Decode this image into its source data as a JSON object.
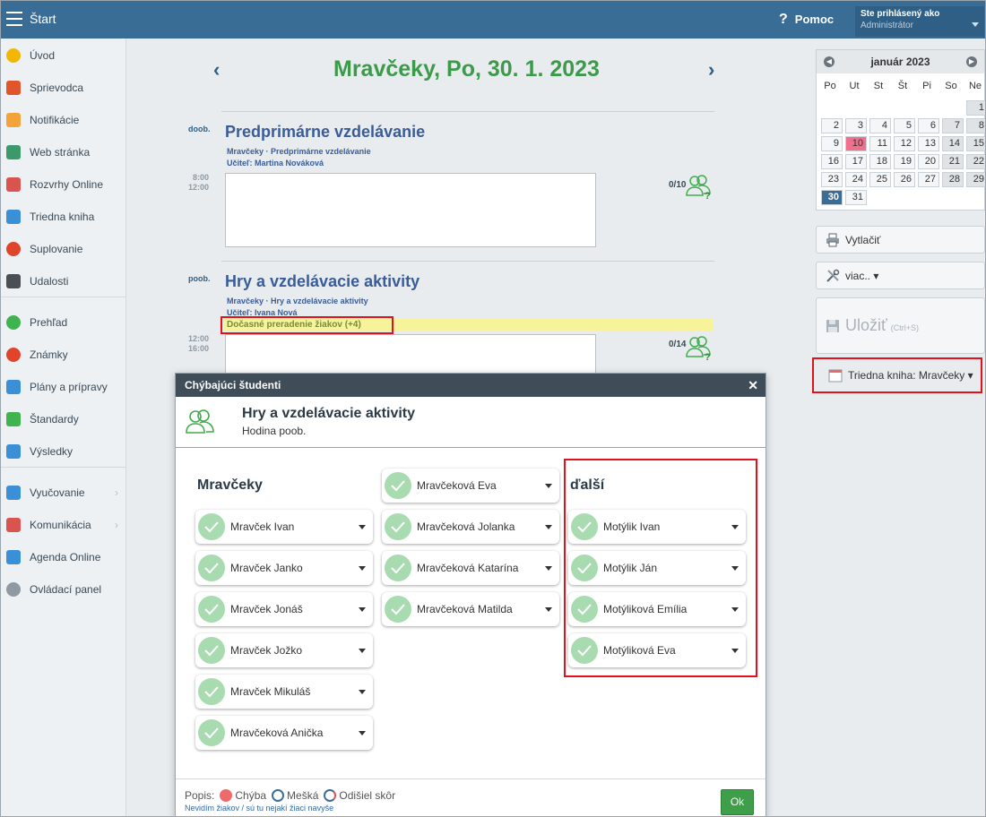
{
  "topbar": {
    "start_label": "Štart",
    "help_label": "Pomoc",
    "user_line1": "Ste prihlásený ako",
    "user_line2": "Administrátor"
  },
  "sidebar": {
    "items": [
      {
        "label": "Úvod",
        "icon": "star-icon",
        "color": "#f2b705"
      },
      {
        "label": "Sprievodca",
        "icon": "wand-icon",
        "color": "#e0552b"
      },
      {
        "label": "Notifikácie",
        "icon": "envelope-icon",
        "color": "#f2a43a"
      },
      {
        "label": "Web stránka",
        "icon": "home-icon",
        "color": "#3c9a6a"
      },
      {
        "label": "Rozvrhy Online",
        "icon": "grid-calendar-icon",
        "color": "#d9534f"
      },
      {
        "label": "Triedna kniha",
        "icon": "book-icon",
        "color": "#3a8fd6"
      },
      {
        "label": "Suplovanie",
        "icon": "person-icon",
        "color": "#e0442b"
      },
      {
        "label": "Udalosti",
        "icon": "calendar-icon",
        "color": "#4a4f55"
      },
      {
        "label": "Prehľad",
        "icon": "check-circle-icon",
        "color": "#3fb34f"
      },
      {
        "label": "Známky",
        "icon": "grade-icon",
        "color": "#e0442b"
      },
      {
        "label": "Plány a prípravy",
        "icon": "briefcase-icon",
        "color": "#3a8fd6"
      },
      {
        "label": "Štandardy",
        "icon": "shield-icon",
        "color": "#3fb34f"
      },
      {
        "label": "Výsledky",
        "icon": "bar-chart-icon",
        "color": "#3a8fd6"
      },
      {
        "label": "Vyučovanie",
        "icon": "open-book-icon",
        "color": "#3a8fd6"
      },
      {
        "label": "Komunikácia",
        "icon": "chat-icon",
        "color": "#d9534f"
      },
      {
        "label": "Agenda Online",
        "icon": "pen-icon",
        "color": "#3a8fd6"
      },
      {
        "label": "Ovládací panel",
        "icon": "gear-icon",
        "color": "#8e99a3"
      }
    ]
  },
  "main": {
    "date_title": "Mravčeky, Po, 30. 1. 2023",
    "lessons": [
      {
        "tag": "doob.",
        "time_start": "8:00",
        "time_end": "12:00",
        "title": "Predprimárne vzdelávanie",
        "sub1": "Mravčeky · Predprimárne vzdelávanie",
        "sub2": "Učiteľ:   Martina Nováková",
        "count": "0/10"
      },
      {
        "tag": "poob.",
        "time_start": "12:00",
        "time_end": "16:00",
        "title": "Hry a vzdelávacie aktivity",
        "sub1": "Mravčeky · Hry a vzdelávacie aktivity",
        "sub2": "Učiteľ:   Ivana Nová",
        "count": "0/14",
        "note": "Dočasné preradenie žiakov (+4)"
      }
    ]
  },
  "calendar": {
    "month": "január 2023",
    "dow": [
      "Po",
      "Ut",
      "St",
      "Št",
      "Pi",
      "So",
      "Ne"
    ],
    "rows": [
      [
        "",
        "",
        "",
        "",
        "",
        "",
        "1"
      ],
      [
        "2",
        "3",
        "4",
        "5",
        "6",
        "7",
        "8"
      ],
      [
        "9",
        "10",
        "11",
        "12",
        "13",
        "14",
        "15"
      ],
      [
        "16",
        "17",
        "18",
        "19",
        "20",
        "21",
        "22"
      ],
      [
        "23",
        "24",
        "25",
        "26",
        "27",
        "28",
        "29"
      ],
      [
        "30",
        "31",
        "",
        "",
        "",
        "",
        ""
      ]
    ],
    "highlight_day": "10",
    "today": "30"
  },
  "actions": {
    "print_label": "Vytlačiť",
    "more_label": "viac.. ▾",
    "save_label": "Uložiť",
    "save_shortcut": "(Ctrl+S)",
    "book_label": "Triedna kniha: Mravčeky ▾"
  },
  "modal": {
    "header": "Chýbajúci študenti",
    "title": "Hry a vzdelávacie aktivity",
    "subtitle": "Hodina poob.",
    "col1_title": "Mravčeky",
    "col3_title": "ďalší",
    "col1": [
      "Mravček Ivan",
      "Mravček Janko",
      "Mravček Jonáš",
      "Mravček Jožko",
      "Mravček Mikuláš",
      "Mravčeková Anička"
    ],
    "col2": [
      "Mravčeková Eva",
      "Mravčeková Jolanka",
      "Mravčeková Katarína",
      "Mravčeková Matilda"
    ],
    "col3": [
      "Motýlik Ivan",
      "Motýlik Ján",
      "Motýliková Emília",
      "Motýliková Eva"
    ],
    "legend_label": "Popis:",
    "legend_error": "Chýba",
    "legend_late": "Mešká",
    "legend_early": "Odišiel skôr",
    "link_text": "Nevidím žiakov / sú tu nejakí žiaci navyše",
    "ok_label": "Ok"
  }
}
